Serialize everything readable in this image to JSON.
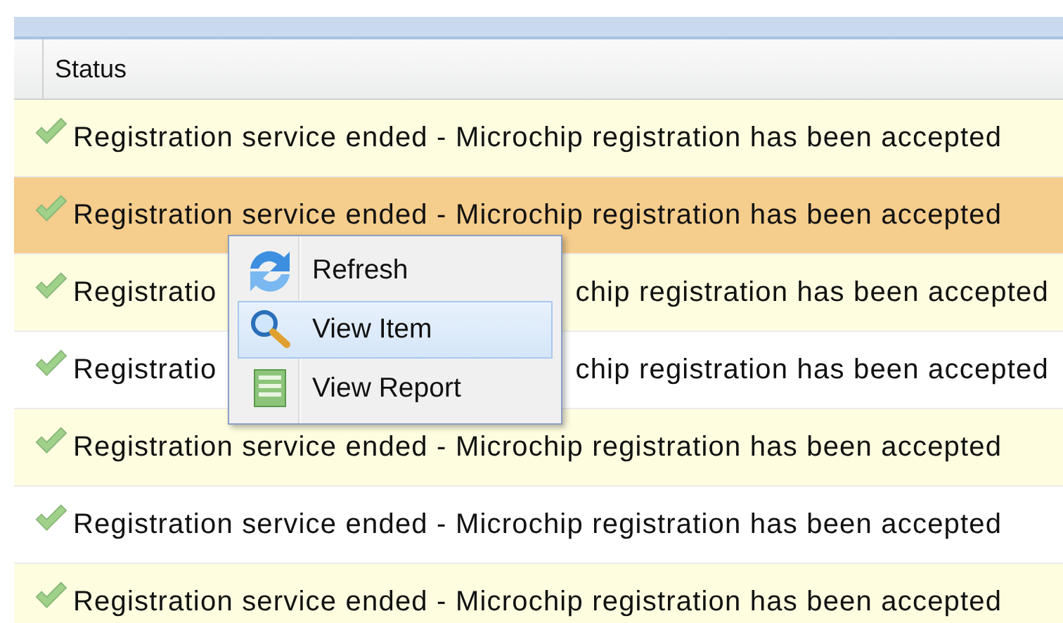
{
  "table": {
    "columns": [
      {
        "label": "Status"
      }
    ],
    "rows": [
      {
        "status": [
          "Registration service ended - Microchip registration has been accepted"
        ],
        "selected": false
      },
      {
        "status": [
          "Registration service ended - Microchip registration has been accepted"
        ],
        "selected": true
      },
      {
        "status": [
          "Registratio",
          "chip registration has been accepted"
        ],
        "selected": false
      },
      {
        "status": [
          "Registratio",
          "chip registration has been accepted"
        ],
        "selected": false
      },
      {
        "status": [
          "Registration service ended - Microchip registration has been accepted"
        ],
        "selected": false
      },
      {
        "status": [
          "Registration service ended - Microchip registration has been accepted"
        ],
        "selected": false
      },
      {
        "status": [
          "Registration service ended - Microchip registration has been accepted"
        ],
        "selected": false
      }
    ]
  },
  "context_menu": {
    "items": [
      {
        "label": "Refresh",
        "kind": "refresh",
        "selected": false
      },
      {
        "label": "View Item",
        "kind": "view",
        "selected": true
      },
      {
        "label": "View Report",
        "kind": "report",
        "selected": false
      }
    ]
  }
}
